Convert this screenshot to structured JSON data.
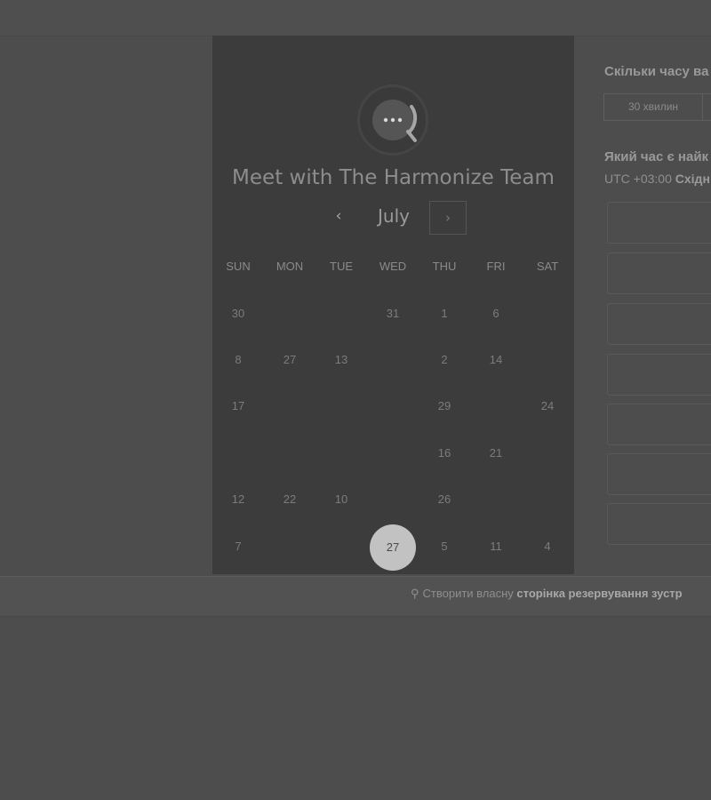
{
  "meeting": {
    "title": "Meet with The Harmonize Team",
    "logo_icon": "chat-bubble-ellipsis-icon"
  },
  "calendar": {
    "month": "July",
    "prev_icon": "‹",
    "next_icon": "›",
    "weekdays": [
      "SUN",
      "MON",
      "TUE",
      "WED",
      "THU",
      "FRI",
      "SAT"
    ],
    "rows": [
      [
        {
          "col": 0,
          "day": "30"
        },
        {
          "col": 3,
          "day": "31"
        },
        {
          "col": 4,
          "day": "1"
        },
        {
          "col": 5,
          "day": "6"
        }
      ],
      [
        {
          "col": 0,
          "day": "8"
        },
        {
          "col": 1,
          "day": "27"
        },
        {
          "col": 2,
          "day": "13"
        },
        {
          "col": 4,
          "day": "2"
        },
        {
          "col": 5,
          "day": "14"
        }
      ],
      [
        {
          "col": 0,
          "day": "17"
        },
        {
          "col": 4,
          "day": "29"
        },
        {
          "col": 6,
          "day": "24"
        }
      ],
      [
        {
          "col": 4,
          "day": "16"
        },
        {
          "col": 5,
          "day": "21"
        }
      ],
      [
        {
          "col": 0,
          "day": "12"
        },
        {
          "col": 1,
          "day": "22"
        },
        {
          "col": 2,
          "day": "10"
        },
        {
          "col": 4,
          "day": "26"
        }
      ],
      [
        {
          "col": 0,
          "day": "7"
        },
        {
          "col": 3,
          "day": "27",
          "selected": true
        },
        {
          "col": 4,
          "day": "5"
        },
        {
          "col": 5,
          "day": "11"
        },
        {
          "col": 6,
          "day": "4"
        }
      ]
    ]
  },
  "duration": {
    "question": "Скільки часу ва",
    "option_label": "30 хвилин"
  },
  "time": {
    "question": "Який час є найк",
    "tz_prefix": "UTC +03:00",
    "tz_name": "Східн",
    "slot_count": 7
  },
  "footer": {
    "prefix": "Створити власну",
    "bold": "сторінка резервування зустр",
    "icon": "hubspot-sprocket-icon"
  },
  "colors": {
    "page_bg": "#4d4d4d",
    "panel_bg": "#3c3c3c",
    "selected_day": "#c2c2c2"
  }
}
